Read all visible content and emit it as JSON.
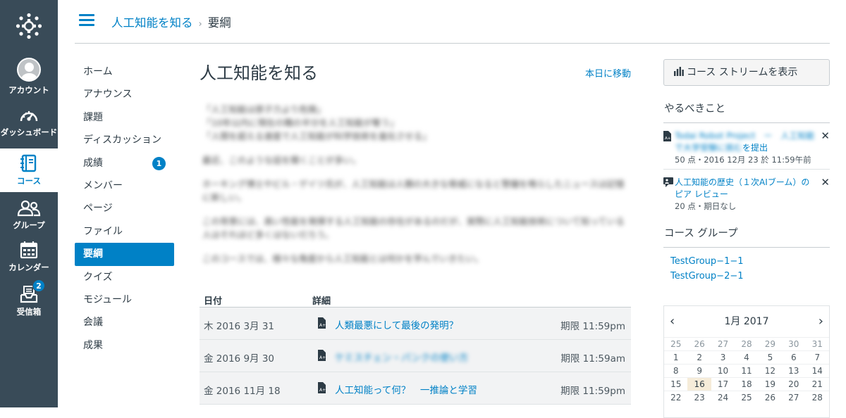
{
  "global_nav": {
    "account": "アカウント",
    "dashboard": "ダッシュボード",
    "courses": "コース",
    "groups": "グループ",
    "calendar": "カレンダー",
    "inbox": "受信箱",
    "inbox_count": "2"
  },
  "breadcrumb": {
    "course": "人工知能を知る",
    "separator": "›",
    "current": "要綱"
  },
  "course_nav": [
    {
      "label": "ホーム"
    },
    {
      "label": "アナウンス"
    },
    {
      "label": "課題"
    },
    {
      "label": "ディスカッション"
    },
    {
      "label": "成績",
      "badge": "1"
    },
    {
      "label": "メンバー"
    },
    {
      "label": "ページ"
    },
    {
      "label": "ファイル"
    },
    {
      "label": "要綱",
      "active": true
    },
    {
      "label": "クイズ"
    },
    {
      "label": "モジュール"
    },
    {
      "label": "会議"
    },
    {
      "label": "成果"
    }
  ],
  "main": {
    "title": "人工知能を知る",
    "jump_today": "本日に移動",
    "blurred_paragraphs": [
      "「人工知能は原子力より危険」\n「10年以内に現在の職の半分を人工知能が奪う」\n「人間を超える速度で人工知能が科学技術を進化させる」",
      "最近、このような話を聞くことが多い。",
      "ホーキング博士やビル・ゲイツ氏が、人工知能は人類の大きな脅威になると警鐘を鳴らしたニュースは記憶に新しい。",
      "この背景には、高い性能を発揮する人工知能の存在があるのだが、実際に人工知能技術について知っている人はそれほど多くはないだろう。",
      "このコースでは、様々な角度から人工知能とは何かを学んでいきたい。"
    ],
    "table": {
      "col_date": "日付",
      "col_detail": "詳細",
      "rows": [
        {
          "date": "木 2016 3月 31",
          "title": "人類最悪にして最後の発明？",
          "due": "期限 11:59pm",
          "blurred": false
        },
        {
          "date": "金 2016 9月 30",
          "title": "ケミスチェン・パンクの使い方",
          "due": "期限 11:59am",
          "blurred": true
        },
        {
          "date": "金 2016 11月 18",
          "title": "人工知能って何？　一推論と学習",
          "due": "期限 11:59pm",
          "blurred": false
        }
      ]
    }
  },
  "sidebar": {
    "stream_button": "コース ストリームを表示",
    "todo_heading": "やるべきこと",
    "todos": [
      {
        "title_blur": "Todai Robot Project　ー　人工知能で大学受験に挑む",
        "title_suffix": "を提出",
        "meta": "50 点・2016 12月 23 於 11:59午前"
      },
      {
        "title_blur": "",
        "title_suffix": "人工知能の歴史（１次AIブーム）のピア レビュー",
        "meta": "20 点・期日なし"
      }
    ],
    "group_heading": "コース グループ",
    "groups": [
      "TestGroup−1−1",
      "TestGroup−2−1"
    ],
    "calendar": {
      "month": "1月 2017",
      "weeks": [
        [
          "25",
          "26",
          "27",
          "28",
          "29",
          "30",
          "31"
        ],
        [
          "1",
          "2",
          "3",
          "4",
          "5",
          "6",
          "7"
        ],
        [
          "8",
          "9",
          "10",
          "11",
          "12",
          "13",
          "14"
        ],
        [
          "15",
          "16",
          "17",
          "18",
          "19",
          "20",
          "21"
        ],
        [
          "22",
          "23",
          "24",
          "25",
          "26",
          "27",
          "28"
        ]
      ],
      "today": "16"
    }
  }
}
